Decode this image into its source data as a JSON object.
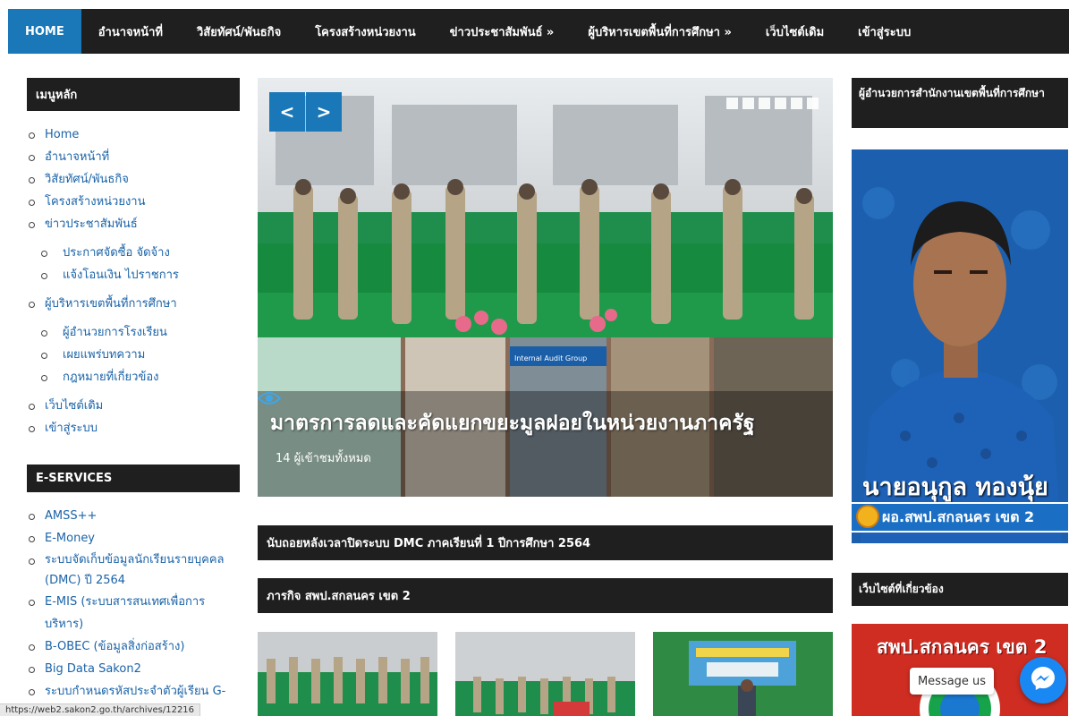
{
  "nav": {
    "items": [
      {
        "label": "HOME"
      },
      {
        "label": "อำนาจหน้าที่"
      },
      {
        "label": "วิสัยทัศน์/พันธกิจ"
      },
      {
        "label": "โครงสร้างหน่วยงาน"
      },
      {
        "label": "ข่าวประชาสัมพันธ์ »"
      },
      {
        "label": "ผู้บริหารเขตพื้นที่การศึกษา »"
      },
      {
        "label": "เว็บไซต์เดิม"
      },
      {
        "label": "เข้าสู่ระบบ"
      }
    ],
    "accent": "#1a78b8"
  },
  "sidebar": {
    "menu_title": "เมนูหลัก",
    "menu": [
      {
        "label": "Home"
      },
      {
        "label": "อำนาจหน้าที่"
      },
      {
        "label": "วิสัยทัศน์/พันธกิจ"
      },
      {
        "label": "โครงสร้างหน่วยงาน"
      },
      {
        "label": "ข่าวประชาสัมพันธ์"
      },
      {
        "label": "ประกาศจัดซื้อ จัดจ้าง"
      },
      {
        "label": "แจ้งโอนเงิน ไปราชการ"
      },
      {
        "label": "ผู้บริหารเขตพื้นที่การศึกษา"
      },
      {
        "label": "ผู้อำนวยการโรงเรียน"
      },
      {
        "label": "เผยแพร่บทความ"
      },
      {
        "label": "กฎหมายที่เกี่ยวข้อง"
      },
      {
        "label": "เว็บไซต์เดิม"
      },
      {
        "label": "เข้าสู่ระบบ"
      }
    ],
    "eservices_title": "E-SERVICES",
    "eservices": [
      {
        "label": "AMSS++"
      },
      {
        "label": "E-Money"
      },
      {
        "label": "ระบบจัดเก็บข้อมูลนักเรียนรายบุคคล (DMC) ปี 2564"
      },
      {
        "label": "E-MIS (ระบบสารสนเทศเพื่อการบริหาร)"
      },
      {
        "label": "B-OBEC (ข้อมูลสิ่งก่อสร้าง)"
      },
      {
        "label": "Big Data Sakon2"
      },
      {
        "label": "ระบบกำหนดรหัสประจำตัวผู้เรียน G-"
      }
    ]
  },
  "slider": {
    "prev": "<",
    "next": ">",
    "caption": "มาตรการลดและคัดแยกขยะมูลฝอยในหน่วยงานภาครัฐ",
    "views": "14 ผู้เข้าชมทั้งหมด",
    "inner_sign": "Internal Audit Group"
  },
  "news_ticker": "นับถอยหลังเวลาปิดระบบ DMC ภาคเรียนที่ 1 ปีการศึกษา 2564",
  "activities_title": "ภารกิจ สพป.สกลนคร เขต 2",
  "right": {
    "director_title": "ผู้อำนวยการสำนักงานเขตพื้นที่การศึกษา",
    "director_name": "นายอนุกูล ทองนุ้ย",
    "director_role": "ผอ.สพป.สกลนคร เขต 2",
    "related_title": "เว็บไซต์ที่เกี่ยวข้อง",
    "related_banner": "สพป.สกลนคร เขต 2"
  },
  "messenger": {
    "bubble": "Message us"
  },
  "status_url": "https://web2.sakon2.go.th/archives/12216"
}
